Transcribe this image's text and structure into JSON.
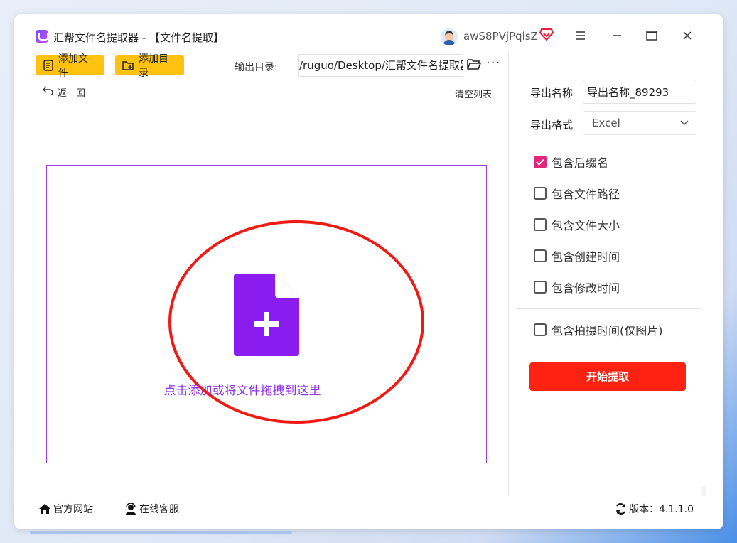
{
  "window": {
    "title": "汇帮文件名提取器 - 【文件名提取】",
    "username": "awS8PVjPqlsZ"
  },
  "toolbar": {
    "add_file": "添加文件",
    "add_dir": "添加目录",
    "output_label": "输出目录:",
    "output_path": "/ruguo/Desktop/汇帮文件名提取器",
    "more": "···",
    "back": "返　回",
    "clear_list": "清空列表"
  },
  "dropzone": {
    "hint": "点击添加或将文件拖拽到这里"
  },
  "settings": {
    "name_label": "导出名称",
    "name_value": "导出名称_89293",
    "format_label": "导出格式",
    "format_value": "Excel",
    "options": [
      {
        "label": "包含后缀名",
        "checked": true
      },
      {
        "label": "包含文件路径",
        "checked": false
      },
      {
        "label": "包含文件大小",
        "checked": false
      },
      {
        "label": "包含创建时间",
        "checked": false
      },
      {
        "label": "包含修改时间",
        "checked": false
      },
      {
        "label": "包含拍摄时间(仅图片)",
        "checked": false
      }
    ],
    "start_button": "开始提取"
  },
  "footer": {
    "site": "官方网站",
    "service": "在线客服",
    "version": "版本：4.1.1.0"
  },
  "colors": {
    "accent_yellow": "#ffc20e",
    "accent_red": "#ff2212",
    "accent_purple": "#8e33e8",
    "check_pink": "#e4267a"
  }
}
